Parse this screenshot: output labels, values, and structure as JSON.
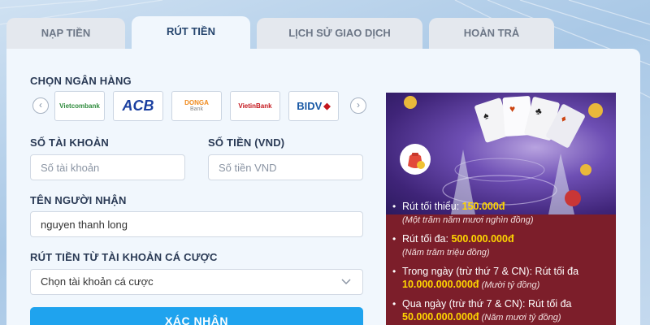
{
  "tabs": [
    {
      "label": "NẠP TIỀN"
    },
    {
      "label": "RÚT TIỀN"
    },
    {
      "label": "LỊCH SỬ GIAO DỊCH"
    },
    {
      "label": "HOÀN TRẢ"
    }
  ],
  "form": {
    "bank_label": "CHỌN NGÂN HÀNG",
    "banks": [
      {
        "name": "Vietcombank",
        "color": "#2e8b3c"
      },
      {
        "name": "ACB",
        "color": "#1a3fa0"
      },
      {
        "name": "DONGA",
        "sub": "Bank",
        "color": "#f08a1c"
      },
      {
        "name": "VietinBank",
        "color": "#c4161c"
      },
      {
        "name": "BIDV",
        "color": "#1a5aa5"
      }
    ],
    "account_label": "SỐ TÀI KHOẢN",
    "account_placeholder": "Số tài khoản",
    "amount_label": "SỐ TIỀN (VND)",
    "amount_placeholder": "Số tiền VND",
    "receiver_label": "TÊN NGƯỜI NHẬN",
    "receiver_value": "nguyen thanh long",
    "source_label": "RÚT TIỀN TỪ TÀI KHOẢN CÁ CƯỢC",
    "source_value": "Chọn tài khoản cá cược",
    "submit_label": "XÁC NHẬN"
  },
  "promo": {
    "items": [
      {
        "text": "Rút tối thiểu: ",
        "amount": "150.000đ",
        "note": "(Một trăm năm mươi nghìn đồng)"
      },
      {
        "text": "Rút tối đa: ",
        "amount": "500.000.000đ",
        "note": "(Năm trăm triệu đồng)"
      },
      {
        "text": "Trong ngày (trừ thứ 7 & CN): Rút tối đa ",
        "amount": "10.000.000.000đ",
        "note": " (Mười tỷ đồng)"
      },
      {
        "text": "Qua ngày (trừ thứ 7 & CN): Rút tối đa ",
        "amount": "50.000.000.000đ",
        "note": " (Năm mươi tỷ đồng)"
      }
    ]
  },
  "colors": {
    "accent": "#1fa3ee",
    "promo_bg": "#7c1e2a",
    "promo_highlight": "#ffd600"
  },
  "icons": {
    "prev": "chevron-left-icon",
    "next": "chevron-right-icon",
    "dropdown": "chevron-down-icon",
    "money_bag": "money-bag-icon"
  }
}
